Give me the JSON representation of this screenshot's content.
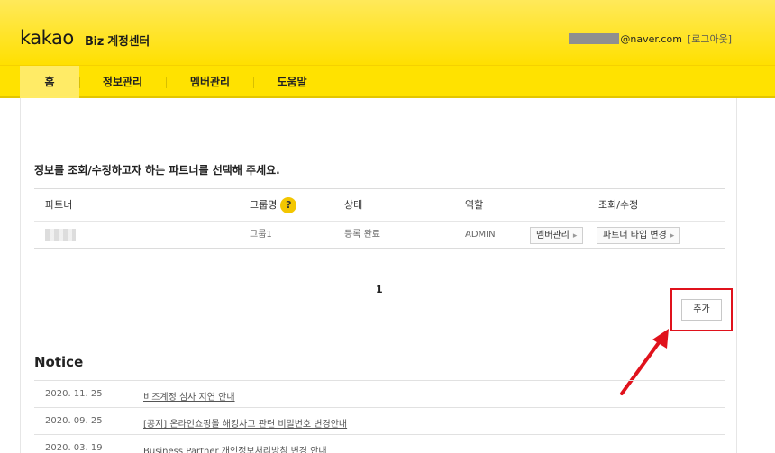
{
  "header": {
    "logo": "kakao",
    "subtitle": "Biz 계정센터",
    "email": "@naver.com",
    "logout_label": "[로그아웃]"
  },
  "nav": {
    "items": [
      {
        "label": "홈",
        "active": true
      },
      {
        "label": "정보관리",
        "active": false
      },
      {
        "label": "멤버관리",
        "active": false
      },
      {
        "label": "도움말",
        "active": false
      }
    ]
  },
  "main": {
    "prompt": "정보를 조회/수정하고자 하는 파트너를 선택해 주세요.",
    "table": {
      "headers": {
        "partner": "파트너",
        "group": "그룹명",
        "help": "?",
        "status": "상태",
        "role": "역할",
        "actions": "조회/수정"
      },
      "rows": [
        {
          "group": "그룹1",
          "status": "등록 완료",
          "role": "ADMIN",
          "member_btn": "멤버관리",
          "type_btn": "파트너 타입 변경"
        }
      ]
    },
    "pagination": {
      "current": "1"
    },
    "add_label": "추가"
  },
  "notice": {
    "title": "Notice",
    "items": [
      {
        "date": "2020. 11. 25",
        "title": "비즈계정 심사 지연 안내",
        "link": true
      },
      {
        "date": "2020. 09. 25",
        "title": "[공지] 온라인쇼핑몰 해킹사고 관련 비밀번호 변경안내",
        "link": true
      },
      {
        "date": "2020. 03. 19",
        "title": "Business Partner 개인정보처리방침 변경 안내",
        "link": false
      }
    ]
  },
  "colors": {
    "header_yellow": "#ffe200",
    "highlight_red": "#e0121c",
    "help_badge": "#f3c600"
  }
}
